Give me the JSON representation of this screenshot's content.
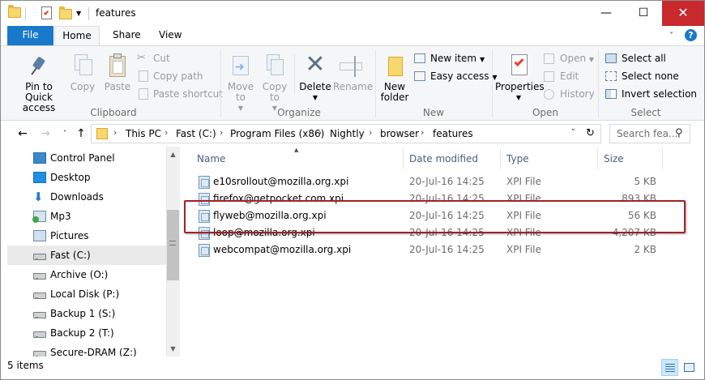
{
  "window": {
    "title": "features",
    "controls": {
      "minimize": "—",
      "maximize": "☐",
      "close": "✕"
    }
  },
  "ribbon_tabs": [
    "File",
    "Home",
    "Share",
    "View"
  ],
  "ribbon": {
    "clipboard": {
      "label": "Clipboard",
      "pin": "Pin to Quick access",
      "copy": "Copy",
      "paste": "Paste",
      "cut": "Cut",
      "copy_path": "Copy path",
      "paste_shortcut": "Paste shortcut"
    },
    "organize": {
      "label": "Organize",
      "move_to": "Move to",
      "copy_to": "Copy to",
      "delete": "Delete",
      "rename": "Rename"
    },
    "new": {
      "label": "New",
      "new_folder": "New folder",
      "new_item": "New item",
      "easy_access": "Easy access"
    },
    "open": {
      "label": "Open",
      "properties": "Properties",
      "open": "Open",
      "edit": "Edit",
      "history": "History"
    },
    "select": {
      "label": "Select",
      "select_all": "Select all",
      "select_none": "Select none",
      "invert": "Invert selection"
    }
  },
  "breadcrumb": [
    "This PC",
    "Fast (C:)",
    "Program Files (x86)",
    "Nightly",
    "browser",
    "features"
  ],
  "search": {
    "placeholder": "Search fea..."
  },
  "nav_items": [
    {
      "label": "Control Panel",
      "icon": "control-panel-icon"
    },
    {
      "label": "Desktop",
      "icon": "desktop-icon"
    },
    {
      "label": "Downloads",
      "icon": "downloads-icon"
    },
    {
      "label": "Mp3",
      "icon": "music-library-icon"
    },
    {
      "label": "Pictures",
      "icon": "pictures-icon"
    },
    {
      "label": "Fast (C:)",
      "icon": "drive-icon",
      "selected": true
    },
    {
      "label": "Archive (O:)",
      "icon": "drive-icon"
    },
    {
      "label": "Local Disk (P:)",
      "icon": "drive-icon"
    },
    {
      "label": "Backup 1 (S:)",
      "icon": "drive-icon"
    },
    {
      "label": "Backup 2 (T:)",
      "icon": "drive-icon"
    },
    {
      "label": "Secure-DRAM (Z:)",
      "icon": "drive-icon"
    }
  ],
  "columns": [
    "Name",
    "Date modified",
    "Type",
    "Size"
  ],
  "files": [
    {
      "name": "e10srollout@mozilla.org.xpi",
      "date": "20-Jul-16 14:25",
      "type": "XPI File",
      "size": "5 KB"
    },
    {
      "name": "firefox@getpocket.com.xpi",
      "date": "20-Jul-16 14:25",
      "type": "XPI File",
      "size": "893 KB"
    },
    {
      "name": "flyweb@mozilla.org.xpi",
      "date": "20-Jul-16 14:25",
      "type": "XPI File",
      "size": "56 KB"
    },
    {
      "name": "loop@mozilla.org.xpi",
      "date": "20-Jul-16 14:25",
      "type": "XPI File",
      "size": "4,207 KB"
    },
    {
      "name": "webcompat@mozilla.org.xpi",
      "date": "20-Jul-16 14:25",
      "type": "XPI File",
      "size": "2 KB"
    }
  ],
  "status": {
    "item_count": "5 items"
  },
  "colors": {
    "accent": "#1979ca",
    "close": "#c7292d",
    "highlight": "#a52024"
  }
}
